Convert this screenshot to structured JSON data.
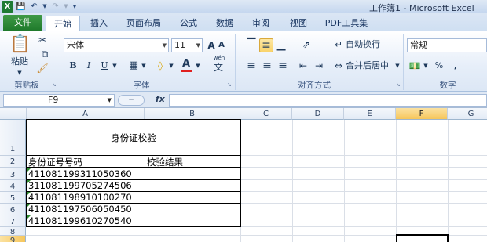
{
  "window": {
    "title": "工作簿1 - Microsoft Excel"
  },
  "qat": {
    "undo_icon": "undo-icon",
    "redo_icon": "redo-icon",
    "save_icon": "save-icon"
  },
  "tabs": [
    "文件",
    "开始",
    "插入",
    "页面布局",
    "公式",
    "数据",
    "审阅",
    "视图",
    "PDF工具集"
  ],
  "ribbon": {
    "clipboard": {
      "paste_label": "粘贴",
      "group_label": "剪贴板"
    },
    "font": {
      "name": "宋体",
      "size": "11",
      "group_label": "字体",
      "bold": "B",
      "italic": "I",
      "underline": "U",
      "grow": "A",
      "shrink": "A",
      "font_color": "A",
      "wen": "wén"
    },
    "alignment": {
      "wrap_label": "自动换行",
      "merge_label": "合并后居中",
      "group_label": "对齐方式"
    },
    "number": {
      "format": "常规",
      "percent": "%",
      "comma": ",",
      "group_label": "数字"
    }
  },
  "formula_bar": {
    "name_box": "F9",
    "fx": "fx",
    "value": ""
  },
  "columns": [
    "A",
    "B",
    "C",
    "D",
    "E",
    "F",
    "G"
  ],
  "rows": [
    "1",
    "2",
    "3",
    "4",
    "5",
    "6",
    "7",
    "8",
    "9"
  ],
  "sheet": {
    "title": "身份证校验",
    "header_a": "身份证号号码",
    "header_b": "校验结果",
    "ids": [
      "411081199311050360",
      "311081199705274506",
      "411081198910100270",
      "411081197506050450",
      "411081199610270540"
    ]
  },
  "colors": {
    "file_tab": "#1f7a2b",
    "selection": "#f6c65b",
    "error_indicator": "#2e8b2e"
  }
}
